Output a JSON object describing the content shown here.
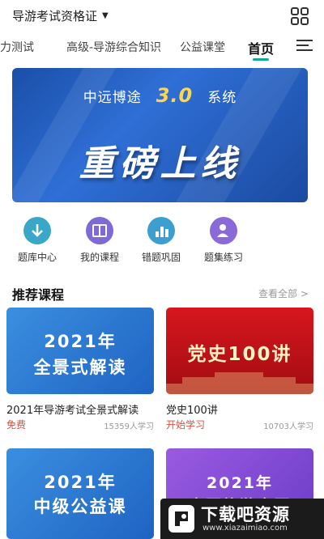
{
  "header": {
    "exam_select_label": "导游考试资格证"
  },
  "tabs": [
    {
      "label": "能力测试"
    },
    {
      "label": "高级-导游综合知识"
    },
    {
      "label": "公益课堂"
    },
    {
      "label": "首页"
    }
  ],
  "banner": {
    "line1_left": "中远博途",
    "version": "3.0",
    "line1_right": "系统",
    "headline": "重磅上线"
  },
  "quick_actions": [
    {
      "label": "题库中心",
      "icon": "download-icon",
      "color": "#3aa7c9"
    },
    {
      "label": "我的课程",
      "icon": "book-icon",
      "color": "#7d6ad6"
    },
    {
      "label": "错题巩固",
      "icon": "chart-icon",
      "color": "#3d9fd0"
    },
    {
      "label": "题集练习",
      "icon": "user-icon",
      "color": "#8a6ad8"
    }
  ],
  "recommended": {
    "title": "推荐课程",
    "see_all": "查看全部 >"
  },
  "courses": [
    {
      "cover_line1": "2021年",
      "cover_line2": "全景式解读",
      "name": "2021年导游考试全景式解读",
      "price": "免费",
      "learners": "15359人学习",
      "bg": "#2e7fd6"
    },
    {
      "cover_line1": "党史100讲",
      "cover_line2": "",
      "name": "党史100讲",
      "price": "开始学习",
      "learners": "10703人学习",
      "bg": "#c7121b"
    },
    {
      "cover_line1": "2021年",
      "cover_line2": "中级公益课",
      "name": "",
      "price": "",
      "learners": "",
      "bg": "#2e7fd6"
    },
    {
      "cover_line1": "2021年",
      "cover_line2": "中国旅游命题",
      "name": "",
      "price": "",
      "learners": "",
      "bg": "#8a52d8"
    }
  ],
  "watermark": {
    "title": "下载吧资源",
    "url": "www.xiazaimiao.com"
  }
}
